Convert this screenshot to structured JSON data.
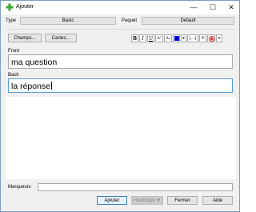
{
  "window": {
    "title": "Ajouter",
    "minimize_glyph": "—",
    "maximize_glyph": "☐",
    "close_glyph": "✕"
  },
  "top": {
    "type_label": "Type",
    "type_value": "Basic",
    "deck_label": "Paquet",
    "deck_value": "Default"
  },
  "toolbar": {
    "fields_button": "Champs...",
    "cards_button": "Cartes...",
    "bold": "B",
    "italic": "I",
    "underline": "U",
    "superscript": "A²",
    "subscript": "A₂",
    "text_color": "A",
    "cloze": "[...]",
    "attach_glyph": "⍟",
    "record_glyph": "●",
    "menu_glyph": "▾"
  },
  "fields": [
    {
      "label": "Front",
      "value": "ma question"
    },
    {
      "label": "Back",
      "value": "la réponse"
    }
  ],
  "tags": {
    "label": "Marqueurs",
    "value": ""
  },
  "buttons": {
    "add": "Ajouter",
    "history": "Historique ▼",
    "close": "Fermer",
    "help": "Aide"
  },
  "colors": {
    "accent_focus": "#5a9bd5",
    "icon_green": "#3aa935",
    "text_color_swatch": "#0000cc",
    "record_red": "#d9232e"
  }
}
